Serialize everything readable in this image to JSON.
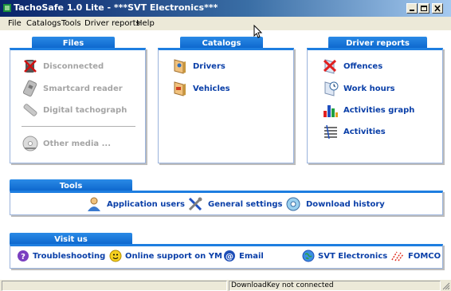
{
  "window": {
    "title": "TachoSafe 1.0 Lite - ***SVT Electronics***"
  },
  "menu": [
    "File",
    "Catalogs",
    "Tools",
    "Driver reports",
    "Help"
  ],
  "files": {
    "header": "Files",
    "items": [
      {
        "label": "Disconnected",
        "icon": "disconnected-icon"
      },
      {
        "label": "Smartcard reader",
        "icon": "smartcard-reader-icon"
      },
      {
        "label": "Digital tachograph",
        "icon": "digital-tachograph-icon"
      },
      {
        "label": "Other media ...",
        "icon": "other-media-icon"
      }
    ]
  },
  "catalogs": {
    "header": "Catalogs",
    "items": [
      {
        "label": "Drivers",
        "icon": "drivers-icon"
      },
      {
        "label": "Vehicles",
        "icon": "vehicles-icon"
      }
    ]
  },
  "reports": {
    "header": "Driver reports",
    "items": [
      {
        "label": "Offences",
        "icon": "offences-icon"
      },
      {
        "label": "Work hours",
        "icon": "work-hours-icon"
      },
      {
        "label": "Activities graph",
        "icon": "activities-graph-icon"
      },
      {
        "label": "Activities",
        "icon": "activities-icon"
      }
    ]
  },
  "tools": {
    "header": "Tools",
    "items": [
      {
        "label": "Application users",
        "icon": "application-users-icon"
      },
      {
        "label": "General settings",
        "icon": "general-settings-icon"
      },
      {
        "label": "Download history",
        "icon": "download-history-icon"
      }
    ]
  },
  "visit": {
    "header": "Visit us",
    "items": [
      {
        "label": "Troubleshooting",
        "icon": "help-icon"
      },
      {
        "label": "Online support on YM",
        "icon": "yahoo-messenger-icon"
      },
      {
        "label": "Email",
        "icon": "email-icon"
      },
      {
        "label": "SVT Electronics",
        "icon": "globe-icon"
      },
      {
        "label": "FOMCO",
        "icon": "fomco-icon"
      }
    ]
  },
  "status": {
    "download_key": "DownloadKey not connected"
  },
  "colors": {
    "panel_header": "#0861c9",
    "link_text": "#0a3fa8",
    "disabled_text": "#a5a5a5"
  }
}
